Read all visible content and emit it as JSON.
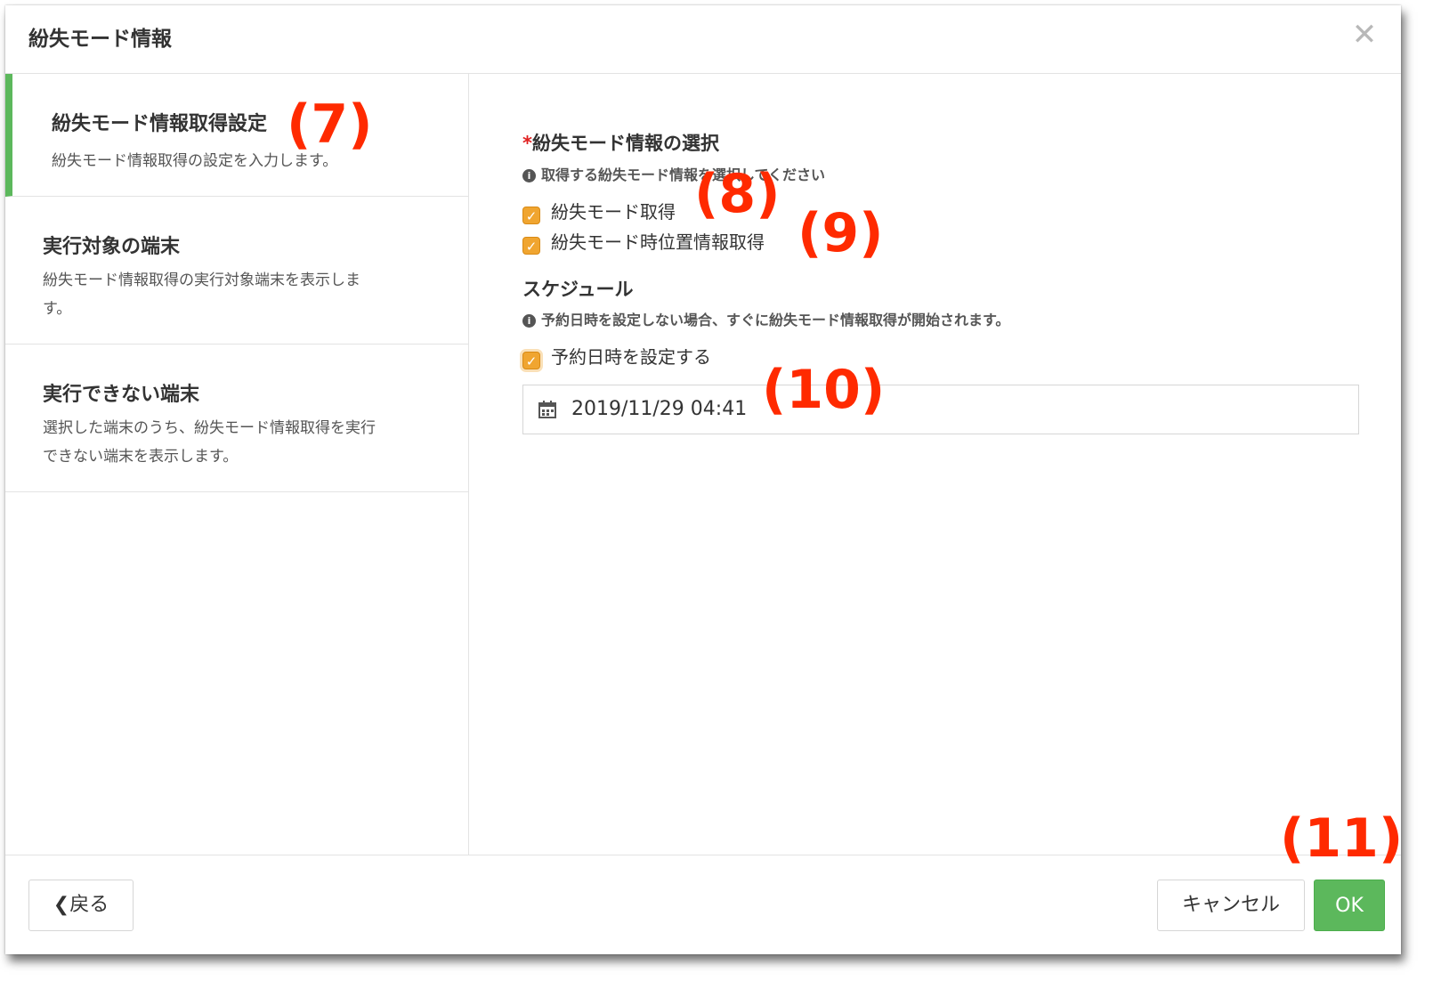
{
  "dialog": {
    "title": "紛失モード情報",
    "close_icon": "close-icon"
  },
  "sidebar": {
    "steps": [
      {
        "title": "紛失モード情報取得設定",
        "desc": "紛失モード情報取得の設定を入力します。",
        "active": true
      },
      {
        "title": "実行対象の端末",
        "desc_line1": "紛失モード情報取得の実行対象端末を表示しま",
        "desc_line2": "す。"
      },
      {
        "title": "実行できない端末",
        "desc_line1": "選択した端末のうち、紛失モード情報取得を実行",
        "desc_line2": "できない端末を表示します。"
      }
    ]
  },
  "main": {
    "selection": {
      "required_mark": "*",
      "label": "紛失モード情報の選択",
      "help": "取得する紛失モード情報を選択してください",
      "options": [
        {
          "label": "紛失モード取得",
          "checked": true
        },
        {
          "label": "紛失モード時位置情報取得",
          "checked": true
        }
      ]
    },
    "schedule": {
      "label": "スケジュール",
      "help": "予約日時を設定しない場合、すぐに紛失モード情報取得が開始されます。",
      "set_datetime_label": "予約日時を設定する",
      "set_datetime_checked": true,
      "datetime_value": "2019/11/29 04:41",
      "calendar_icon": "calendar-icon"
    }
  },
  "footer": {
    "back_label": "戻る",
    "cancel_label": "キャンセル",
    "ok_label": "OK"
  },
  "annotations": {
    "a7": "(7)",
    "a8": "(8)",
    "a9": "(9)",
    "a10": "(10)",
    "a11": "(11)"
  },
  "colors": {
    "accent_green": "#5cb85c",
    "checkbox_orange": "#f0a530",
    "annotation_red": "#ff2a00",
    "required_red": "#e02020"
  }
}
